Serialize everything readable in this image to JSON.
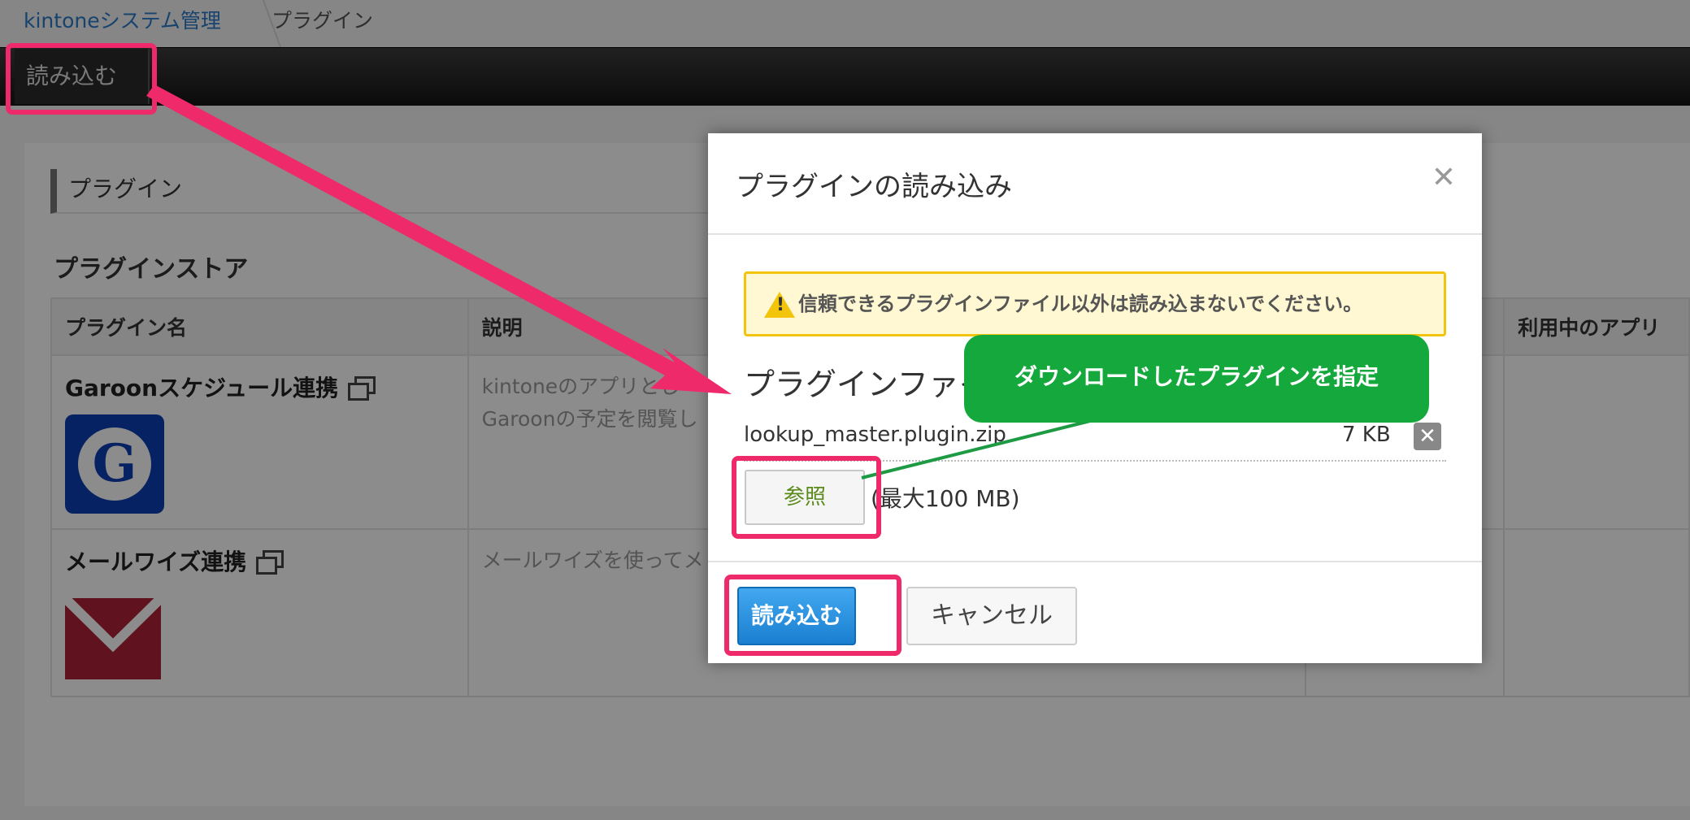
{
  "breadcrumb": {
    "root": "kintoneシステム管理",
    "current": "プラグイン"
  },
  "toolbar": {
    "import_label": "読み込む"
  },
  "page": {
    "section_title": "プラグイン",
    "store_title": "プラグインストア",
    "columns": [
      "プラグイン名",
      "説明",
      "",
      "利用中のアプリ"
    ],
    "rows": [
      {
        "name": "Garoonスケジュール連携",
        "desc_1": "kintoneのアプリとし",
        "desc_2": "Garoonの予定を閲覧し",
        "logo_letter": "G"
      },
      {
        "name": "メールワイズ連携",
        "desc_1": "メールワイズを使ってメ"
      }
    ]
  },
  "modal": {
    "title": "プラグインの読み込み",
    "warning": "信頼できるプラグインファイル以外は読み込まないでください。",
    "warning_glyph": "!",
    "file_label": "プラグインファイ",
    "file_name": "lookup_master.plugin.zip",
    "file_size": "7 KB",
    "remove_glyph": "✕",
    "close_glyph": "✕",
    "browse_label": "参照",
    "max_size": "(最大100 MB)",
    "import_label": "読み込む",
    "cancel_label": "キャンセル"
  },
  "annotation": {
    "callout": "ダウンロードしたプラグインを指定"
  },
  "colors": {
    "highlight": "#ee2a6b",
    "callout": "#14a83d",
    "primary": "#1a7fd0",
    "warning": "#f2c40c"
  }
}
